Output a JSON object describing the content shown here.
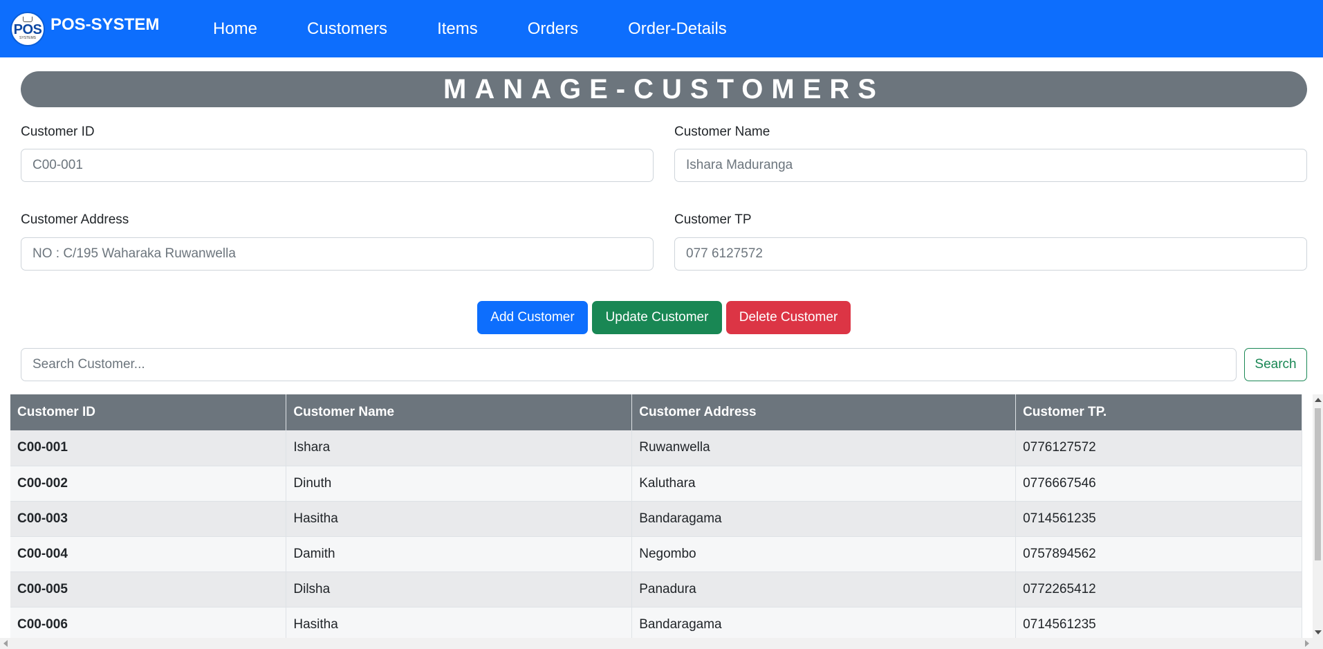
{
  "navbar": {
    "brand_logo_text": "POS",
    "brand_logo_sub": "SYSTEMS",
    "brand_name": "POS-SYSTEM",
    "links": [
      "Home",
      "Customers",
      "Items",
      "Orders",
      "Order-Details"
    ],
    "bg_color": "#0d6efd"
  },
  "page": {
    "title": "MANAGE-CUSTOMERS"
  },
  "form": {
    "customer_id": {
      "label": "Customer ID",
      "placeholder": "C00-001",
      "value": ""
    },
    "customer_name": {
      "label": "Customer Name",
      "placeholder": "Ishara Maduranga",
      "value": ""
    },
    "customer_address": {
      "label": "Customer Address",
      "placeholder": "NO : C/195 Waharaka Ruwanwella",
      "value": ""
    },
    "customer_tp": {
      "label": "Customer TP",
      "placeholder": "077 6127572",
      "value": ""
    }
  },
  "actions": {
    "add_label": "Add Customer",
    "update_label": "Update Customer",
    "delete_label": "Delete Customer"
  },
  "search": {
    "placeholder": "Search Customer...",
    "button_label": "Search"
  },
  "table": {
    "headers": [
      "Customer ID",
      "Customer Name",
      "Customer Address",
      "Customer TP."
    ],
    "rows": [
      [
        "C00-001",
        "Ishara",
        "Ruwanwella",
        "0776127572"
      ],
      [
        "C00-002",
        "Dinuth",
        "Kaluthara",
        "0776667546"
      ],
      [
        "C00-003",
        "Hasitha",
        "Bandaragama",
        "0714561235"
      ],
      [
        "C00-004",
        "Damith",
        "Negombo",
        "0757894562"
      ],
      [
        "C00-005",
        "Dilsha",
        "Panadura",
        "0772265412"
      ],
      [
        "C00-006",
        "Hasitha",
        "Bandaragama",
        "0714561235"
      ]
    ]
  },
  "colors": {
    "primary": "#0d6efd",
    "success": "#198754",
    "danger": "#dc3545",
    "secondary": "#6c757d"
  }
}
